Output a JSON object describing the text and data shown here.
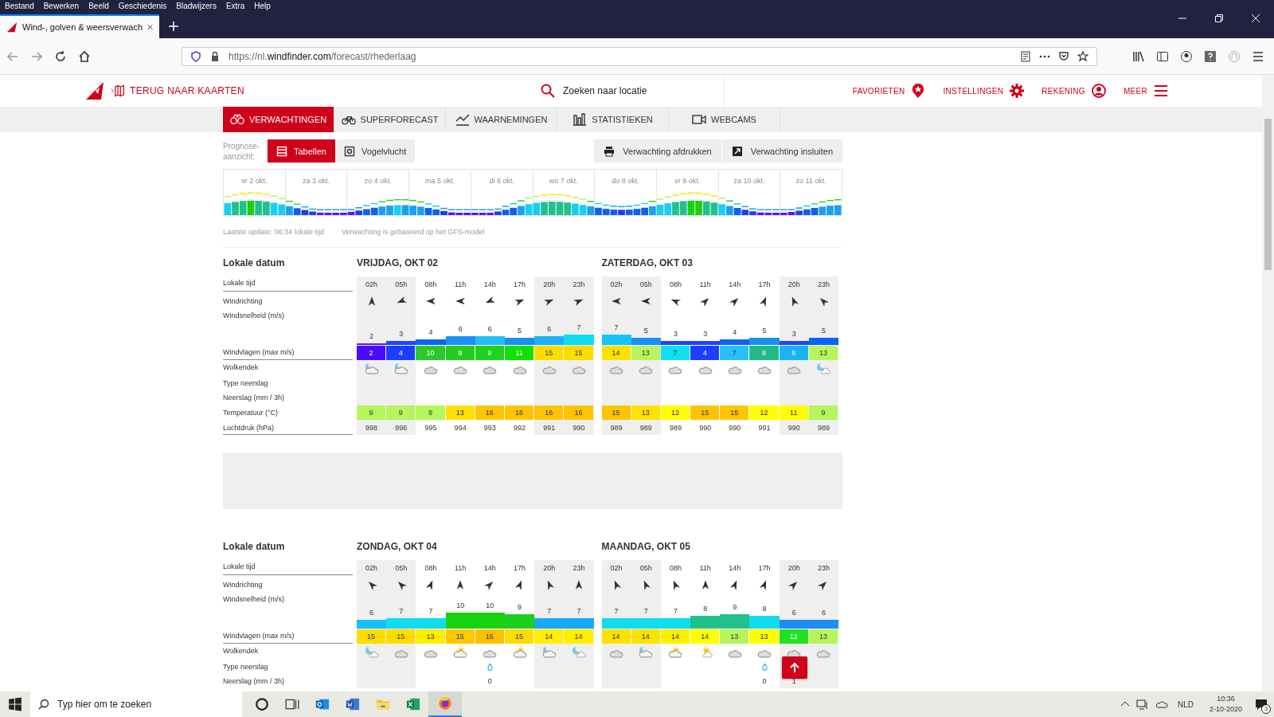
{
  "browser": {
    "menu": [
      "Bestand",
      "Bewerken",
      "Beeld",
      "Geschiedenis",
      "Bladwijzers",
      "Extra",
      "Help"
    ],
    "tab": {
      "title": "Wind-, golven & weersverwach"
    },
    "url": "https://nl.**windfinder.com**/forecast/rhederlaag"
  },
  "header": {
    "back_label": "TERUG NAAR KAARTEN",
    "search_placeholder": "Zoeken naar locatie",
    "links": [
      {
        "label": "FAVORIETEN",
        "kind": "star"
      },
      {
        "label": "INSTELLINGEN",
        "kind": "gear"
      },
      {
        "label": "REKENING",
        "kind": "user"
      },
      {
        "label": "MEER",
        "kind": "menu"
      }
    ]
  },
  "nav": [
    {
      "label": "VERWACHTINGEN",
      "kind": "binoculars",
      "selected": true
    },
    {
      "label": "SUPERFORECAST",
      "kind": "bicycle",
      "selected": false
    },
    {
      "label": "WAARNEMINGEN",
      "kind": "line",
      "selected": false
    },
    {
      "label": "STATISTIEKEN",
      "kind": "bars",
      "selected": false
    },
    {
      "label": "WEBCAMS",
      "kind": "camera",
      "selected": false
    }
  ],
  "view": {
    "label": "Prognose-aanzicht:",
    "options": [
      {
        "label": "Tabellen",
        "kind": "list",
        "selected": true
      },
      {
        "label": "Vogelvlucht",
        "kind": "map",
        "selected": false
      }
    ],
    "actions": [
      {
        "label": "Verwachting afdrukken",
        "kind": "print"
      },
      {
        "label": "Verwachting insluiten",
        "kind": "embed"
      }
    ]
  },
  "overview": {
    "days": [
      "vr 2 okt.",
      "za 3 okt.",
      "zo 4 okt.",
      "ma 5 okt.",
      "di 6 okt.",
      "wo 7 okt.",
      "do 8 okt.",
      "vr 9 okt.",
      "za 10 okt.",
      "zo 11 okt."
    ]
  },
  "update": [
    "Laatste update: 06:34 lokale tijd",
    "Verwachting is gebaseerd op het GFS-model"
  ],
  "sections": [
    {
      "date_label": "Lokale datum",
      "rows": [
        {
          "label": "Lokale tijd",
          "kind": "hour"
        },
        {
          "label": "Windrichting",
          "kind": "direction"
        },
        {
          "label": "Windsnelheid  (m/s)",
          "kind": "speed"
        },
        {
          "label": "Windvlagen  (max m/s)",
          "kind": "gust"
        },
        {
          "label": "Wolkendek",
          "kind": "sky"
        },
        {
          "label": "Type neerslag",
          "kind": "precip_type"
        },
        {
          "label": "Neerslag  (mm / 3h)",
          "kind": "precip"
        },
        {
          "label": "Temperatuur  (°C)",
          "kind": "temp"
        },
        {
          "label": "Luchtdruk  (hPa)",
          "kind": "pressure"
        }
      ],
      "days": [
        {
          "title": "VRIJDAG, OKT 02",
          "columns": [
            {
              "hour": "02h",
              "night": true,
              "direction": {
                "kind": "n"
              },
              "speed": {
                "value": "2",
                "color": "#5a16f5"
              },
              "gust": {
                "value": "2",
                "color": "#4a0cff"
              },
              "sky": {
                "kind": "night-partly"
              },
              "temp": {
                "value": "9",
                "color": "#b6f55c"
              },
              "pressure": "998"
            },
            {
              "hour": "05h",
              "night": true,
              "direction": {
                "kind": "wsw"
              },
              "speed": {
                "value": "3",
                "color": "#1d46f5"
              },
              "gust": {
                "value": "4",
                "color": "#1f3dff"
              },
              "sky": {
                "kind": "night-partly"
              },
              "temp": {
                "value": "9",
                "color": "#b6f55c"
              },
              "pressure": "996"
            },
            {
              "hour": "08h",
              "night": false,
              "direction": {
                "kind": "w"
              },
              "speed": {
                "value": "4",
                "color": "#0a64f5"
              },
              "gust": {
                "value": "10",
                "color": "#2cc82c"
              },
              "sky": {
                "kind": "cloudy"
              },
              "temp": {
                "value": "9",
                "color": "#b6f55c"
              },
              "pressure": "995"
            },
            {
              "hour": "11h",
              "night": false,
              "direction": {
                "kind": "w"
              },
              "speed": {
                "value": "6",
                "color": "#1a90f5"
              },
              "gust": {
                "value": "9",
                "color": "#24cc20"
              },
              "sky": {
                "kind": "cloudy"
              },
              "temp": {
                "value": "13",
                "color": "#ffe100"
              },
              "pressure": "994"
            },
            {
              "hour": "14h",
              "night": false,
              "direction": {
                "kind": "wsw"
              },
              "speed": {
                "value": "6",
                "color": "#22bdf8"
              },
              "gust": {
                "value": "9",
                "color": "#1fd21f"
              },
              "sky": {
                "kind": "cloudy"
              },
              "temp": {
                "value": "16",
                "color": "#ffc400"
              },
              "pressure": "993"
            },
            {
              "hour": "17h",
              "night": false,
              "direction": {
                "kind": "ene"
              },
              "speed": {
                "value": "5",
                "color": "#1a90f5"
              },
              "gust": {
                "value": "11",
                "color": "#12e000"
              },
              "sky": {
                "kind": "cloudy"
              },
              "temp": {
                "value": "16",
                "color": "#ffc400"
              },
              "pressure": "992"
            },
            {
              "hour": "20h",
              "night": true,
              "direction": {
                "kind": "ene"
              },
              "speed": {
                "value": "6",
                "color": "#1cb0f8"
              },
              "gust": {
                "value": "15",
                "color": "#ffdc00"
              },
              "sky": {
                "kind": "cloudy"
              },
              "temp": {
                "value": "16",
                "color": "#ffc400"
              },
              "pressure": "991"
            },
            {
              "hour": "23h",
              "night": true,
              "direction": {
                "kind": "ene"
              },
              "speed": {
                "value": "7",
                "color": "#0fdcf0"
              },
              "gust": {
                "value": "15",
                "color": "#ffdc00"
              },
              "sky": {
                "kind": "cloudy"
              },
              "temp": {
                "value": "16",
                "color": "#ffc400"
              },
              "pressure": "990"
            }
          ]
        },
        {
          "title": "ZATERDAG, OKT 03",
          "columns": [
            {
              "hour": "02h",
              "night": true,
              "direction": {
                "kind": "w"
              },
              "speed": {
                "value": "7",
                "color": "#14c4fa"
              },
              "gust": {
                "value": "14",
                "color": "#ffe100"
              },
              "sky": {
                "kind": "cloudy"
              },
              "temp": {
                "value": "15",
                "color": "#ffc400"
              },
              "pressure": "989"
            },
            {
              "hour": "05h",
              "night": true,
              "direction": {
                "kind": "w"
              },
              "speed": {
                "value": "5",
                "color": "#1a90f5"
              },
              "gust": {
                "value": "13",
                "color": "#b6f55c"
              },
              "sky": {
                "kind": "cloudy"
              },
              "temp": {
                "value": "13",
                "color": "#ffe100"
              },
              "pressure": "989"
            },
            {
              "hour": "08h",
              "night": false,
              "direction": {
                "kind": "wnw"
              },
              "speed": {
                "value": "3",
                "color": "#1d46f5"
              },
              "gust": {
                "value": "7",
                "color": "#0fe0f0"
              },
              "sky": {
                "kind": "cloudy"
              },
              "temp": {
                "value": "12",
                "color": "#ffff00"
              },
              "pressure": "989"
            },
            {
              "hour": "11h",
              "night": false,
              "direction": {
                "kind": "ne"
              },
              "speed": {
                "value": "3",
                "color": "#1d46f5"
              },
              "gust": {
                "value": "4",
                "color": "#1f3dff"
              },
              "sky": {
                "kind": "cloudy"
              },
              "temp": {
                "value": "15",
                "color": "#ffc400"
              },
              "pressure": "990"
            },
            {
              "hour": "14h",
              "night": false,
              "direction": {
                "kind": "ne"
              },
              "speed": {
                "value": "4",
                "color": "#0a64f5"
              },
              "gust": {
                "value": "7",
                "color": "#28c0fa"
              },
              "sky": {
                "kind": "cloudy"
              },
              "temp": {
                "value": "15",
                "color": "#ffc400"
              },
              "pressure": "990"
            },
            {
              "hour": "17h",
              "night": false,
              "direction": {
                "kind": "nne"
              },
              "speed": {
                "value": "5",
                "color": "#1a90f5"
              },
              "gust": {
                "value": "9",
                "color": "#22bb88"
              },
              "sky": {
                "kind": "cloudy"
              },
              "temp": {
                "value": "12",
                "color": "#ffff00"
              },
              "pressure": "991"
            },
            {
              "hour": "20h",
              "night": true,
              "direction": {
                "kind": "nnw"
              },
              "speed": {
                "value": "3",
                "color": "#1d46f5"
              },
              "gust": {
                "value": "6",
                "color": "#18b4fa"
              },
              "sky": {
                "kind": "cloudy"
              },
              "temp": {
                "value": "11",
                "color": "#ffff00"
              },
              "pressure": "990"
            },
            {
              "hour": "23h",
              "night": true,
              "direction": {
                "kind": "nw"
              },
              "speed": {
                "value": "5",
                "color": "#0a64f5"
              },
              "gust": {
                "value": "13",
                "color": "#b6f55c"
              },
              "sky": {
                "kind": "night-light"
              },
              "temp": {
                "value": "9",
                "color": "#b6f55c"
              },
              "pressure": "989"
            }
          ]
        }
      ]
    },
    {
      "date_label": "Lokale datum",
      "rows": [
        {
          "label": "Lokale tijd",
          "kind": "hour"
        },
        {
          "label": "Windrichting",
          "kind": "direction"
        },
        {
          "label": "Windsnelheid  (m/s)",
          "kind": "speed"
        },
        {
          "label": "Windvlagen  (max m/s)",
          "kind": "gust"
        },
        {
          "label": "Wolkendek",
          "kind": "sky"
        },
        {
          "label": "Type neerslag",
          "kind": "precip_type"
        },
        {
          "label": "Neerslag  (mm / 3h)",
          "kind": "precip"
        }
      ],
      "days": [
        {
          "title": "ZONDAG, OKT 04",
          "columns": [
            {
              "hour": "02h",
              "night": true,
              "direction": {
                "kind": "nw"
              },
              "speed": {
                "value": "6",
                "color": "#14c0fa"
              },
              "gust": {
                "value": "15",
                "color": "#ffdc00"
              },
              "sky": {
                "kind": "night-light"
              }
            },
            {
              "hour": "05h",
              "night": true,
              "direction": {
                "kind": "nw"
              },
              "speed": {
                "value": "7",
                "color": "#0fdcf0"
              },
              "gust": {
                "value": "15",
                "color": "#ffdc00"
              },
              "sky": {
                "kind": "cloudy"
              }
            },
            {
              "hour": "08h",
              "night": false,
              "direction": {
                "kind": "nne"
              },
              "speed": {
                "value": "7",
                "color": "#0fdcf0"
              },
              "gust": {
                "value": "13",
                "color": "#ffee00"
              },
              "sky": {
                "kind": "cloudy"
              }
            },
            {
              "hour": "11h",
              "night": false,
              "direction": {
                "kind": "n"
              },
              "speed": {
                "value": "10",
                "color": "#19d10f"
              },
              "gust": {
                "value": "15",
                "color": "#ffc800"
              },
              "sky": {
                "kind": "partly-sun"
              }
            },
            {
              "hour": "14h",
              "night": false,
              "direction": {
                "kind": "ne"
              },
              "speed": {
                "value": "10",
                "color": "#19d10f"
              },
              "gust": {
                "value": "16",
                "color": "#ffc000"
              },
              "sky": {
                "kind": "cloudy"
              },
              "precip_type": {
                "kind": "rain"
              },
              "precip": "0"
            },
            {
              "hour": "17h",
              "night": false,
              "direction": {
                "kind": "nne"
              },
              "speed": {
                "value": "9",
                "color": "#1ccf1c"
              },
              "gust": {
                "value": "15",
                "color": "#ffdc00"
              },
              "sky": {
                "kind": "partly-sun"
              }
            },
            {
              "hour": "20h",
              "night": true,
              "direction": {
                "kind": "nnw"
              },
              "speed": {
                "value": "7",
                "color": "#18a8fa"
              },
              "gust": {
                "value": "14",
                "color": "#ffee00"
              },
              "sky": {
                "kind": "night-partly"
              }
            },
            {
              "hour": "23h",
              "night": true,
              "direction": {
                "kind": "n"
              },
              "speed": {
                "value": "7",
                "color": "#18a8fa"
              },
              "gust": {
                "value": "14",
                "color": "#ffee00"
              },
              "sky": {
                "kind": "night-light"
              }
            }
          ]
        },
        {
          "title": "MAANDAG, OKT 05",
          "columns": [
            {
              "hour": "02h",
              "night": true,
              "direction": {
                "kind": "nnw"
              },
              "speed": {
                "value": "7",
                "color": "#0fdcf0"
              },
              "gust": {
                "value": "14",
                "color": "#ffe100"
              },
              "sky": {
                "kind": "cloudy"
              }
            },
            {
              "hour": "05h",
              "night": true,
              "direction": {
                "kind": "nnw"
              },
              "speed": {
                "value": "7",
                "color": "#0fdcf0"
              },
              "gust": {
                "value": "14",
                "color": "#ffe100"
              },
              "sky": {
                "kind": "night-partly"
              }
            },
            {
              "hour": "08h",
              "night": false,
              "direction": {
                "kind": "nnw"
              },
              "speed": {
                "value": "7",
                "color": "#0fdcf0"
              },
              "gust": {
                "value": "14",
                "color": "#fff000"
              },
              "sky": {
                "kind": "partly-sun"
              }
            },
            {
              "hour": "11h",
              "night": false,
              "direction": {
                "kind": "n"
              },
              "speed": {
                "value": "8",
                "color": "#22c08c"
              },
              "gust": {
                "value": "14",
                "color": "#ffff00"
              },
              "sky": {
                "kind": "sunny"
              }
            },
            {
              "hour": "14h",
              "night": false,
              "direction": {
                "kind": "nne"
              },
              "speed": {
                "value": "9",
                "color": "#22c08c"
              },
              "gust": {
                "value": "13",
                "color": "#b6f55c"
              },
              "sky": {
                "kind": "cloudy"
              }
            },
            {
              "hour": "17h",
              "night": false,
              "direction": {
                "kind": "nne"
              },
              "speed": {
                "value": "8",
                "color": "#0fdcf0"
              },
              "gust": {
                "value": "13",
                "color": "#ffff00"
              },
              "sky": {
                "kind": "cloudy"
              },
              "precip_type": {
                "kind": "rain"
              },
              "precip": "0"
            },
            {
              "hour": "20h",
              "night": true,
              "direction": {
                "kind": "ne"
              },
              "speed": {
                "value": "6",
                "color": "#1e8cf5"
              },
              "gust": {
                "value": "12",
                "color": "#22e022"
              },
              "sky": {
                "kind": "cloudy"
              },
              "precip": "1"
            },
            {
              "hour": "23h",
              "night": true,
              "direction": {
                "kind": "ne"
              },
              "speed": {
                "value": "6",
                "color": "#1e8cf5"
              },
              "gust": {
                "value": "13",
                "color": "#b6f55c"
              },
              "sky": {
                "kind": "cloudy"
              }
            }
          ]
        }
      ]
    }
  ],
  "taskbar": {
    "search_placeholder": "Typ hier om te zoeken",
    "language": "NLD",
    "time": "10:36",
    "date": "2-10-2020",
    "notifications": "3"
  }
}
